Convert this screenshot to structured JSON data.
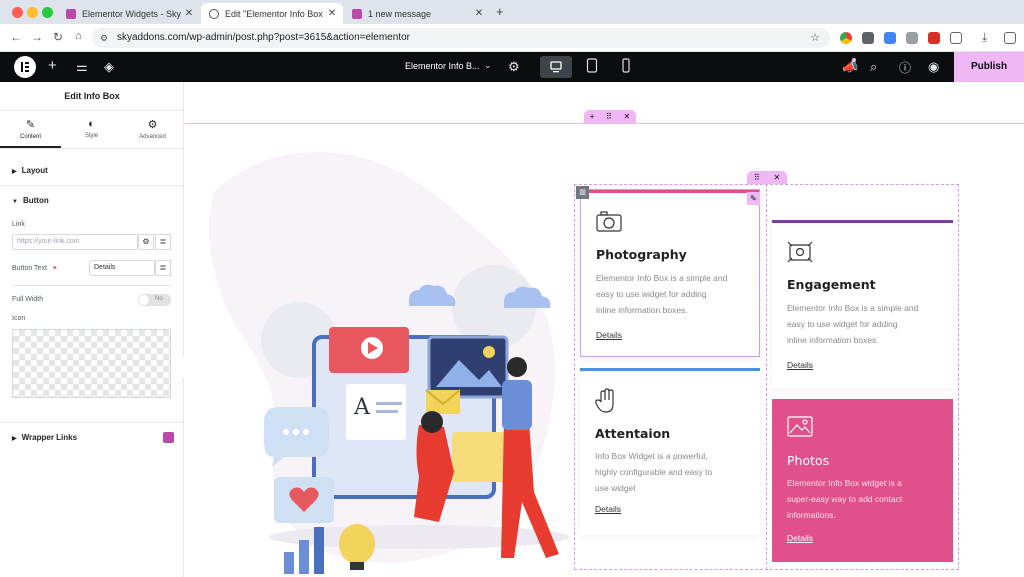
{
  "browser": {
    "tabs": [
      {
        "title": "Elementor Widgets - Sky Add..."
      },
      {
        "title": "Edit \"Elementor Info Box Wid..."
      },
      {
        "title": "1 new message"
      }
    ],
    "new_tab": "+",
    "url": "skyaddons.com/wp-admin/post.php?post=3615&action=elementor"
  },
  "topbar": {
    "page_title": "Elementor Info B...",
    "publish_label": "Publish"
  },
  "panel": {
    "title": "Edit Info Box",
    "tabs": [
      {
        "label": "Content",
        "icon": "pencil-icon"
      },
      {
        "label": "Style",
        "icon": "contrast-icon"
      },
      {
        "label": "Advanced",
        "icon": "gear-icon"
      }
    ],
    "sections": {
      "layout": "Layout",
      "button": "Button",
      "wrapper_links": "Wrapper Links"
    },
    "link_label": "Link",
    "link_placeholder": "https://your-link.com",
    "button_text_label": "Button Text",
    "button_text_value": "Details",
    "full_width_label": "Full Width",
    "full_width_toggle": "No",
    "icon_label": "Icon"
  },
  "canvas": {
    "boxes": [
      {
        "title": "Photography",
        "desc_lines": [
          "Elementor Info Box is a simple and",
          "easy to use widget for adding",
          "inline information boxes."
        ],
        "link": "Details",
        "icon": "camera-icon",
        "accent": "#e24d8f"
      },
      {
        "title": "Engagement",
        "desc_lines": [
          "Elementor Info Box is a simple and",
          "easy to use widget for adding",
          "inline information boxes."
        ],
        "link": "Details",
        "icon": "engagement-icon",
        "accent": "#7d3ca0"
      },
      {
        "title": "Attentaion",
        "desc_lines": [
          "Info Box Widget is a powerful,",
          "highly configurable and easy to",
          "use widget"
        ],
        "link": "Details",
        "icon": "hand-icon",
        "accent": "#4a90e2"
      },
      {
        "title": "Photos",
        "desc_lines": [
          "Elementor Info Box widget is a",
          "super-easy way to add contact",
          "informations."
        ],
        "link": "Details",
        "icon": "image-icon",
        "accent": "#e2508b"
      }
    ]
  },
  "colors": {
    "elementor_dark": "#0c0d0e",
    "publish_bg": "#f0b7f5",
    "pink": "#e2508b",
    "purple": "#7d3ca0",
    "blue": "#4a90e2"
  }
}
